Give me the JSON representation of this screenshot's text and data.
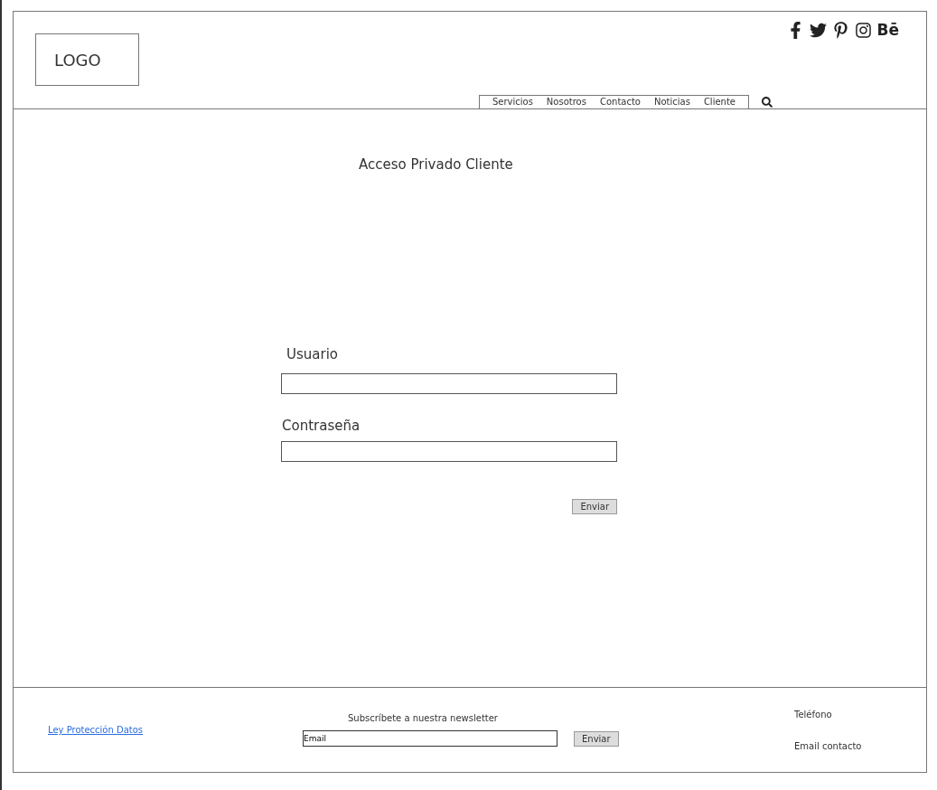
{
  "header": {
    "logo": "LOGO",
    "social": [
      {
        "kind": "facebook"
      },
      {
        "kind": "twitter"
      },
      {
        "kind": "pinterest"
      },
      {
        "kind": "instagram"
      },
      {
        "kind": "text",
        "label": "Bē"
      }
    ],
    "nav": [
      {
        "label": "Servicios"
      },
      {
        "label": "Nosotros"
      },
      {
        "label": "Contacto"
      },
      {
        "label": "Noticias"
      },
      {
        "label": "Cliente"
      }
    ]
  },
  "main": {
    "title": "Acceso Privado Cliente",
    "fields": [
      {
        "label": "Usuario"
      },
      {
        "label": "Contraseña"
      }
    ],
    "submit": "Enviar"
  },
  "footer": {
    "link": "Ley Protección Datos",
    "newsletter": {
      "title": "Subscríbete a nuestra newsletter",
      "value": "Email",
      "button": "Enviar"
    },
    "contact": [
      "Teléfono",
      "Email contacto"
    ]
  }
}
